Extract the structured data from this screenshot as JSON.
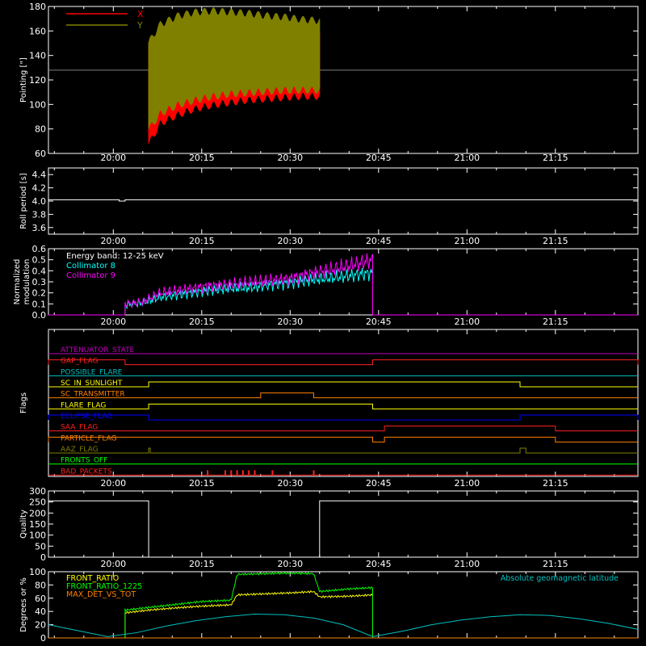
{
  "colors": {
    "background": "#000000",
    "axis": "#ffffff",
    "x_series": "#ff0000",
    "y_series": "#808000",
    "roll": "#ffffff",
    "coll8": "#00ffff",
    "coll9": "#ff00ff",
    "quality": "#ffffff",
    "front_ratio": "#ffff00",
    "front_ratio_1225": "#00ff00",
    "max_det": "#ff8000",
    "geomag": "#00c0c0",
    "pointing_ref": "#808080"
  },
  "time_axis": {
    "start": "19:49",
    "end": "21:29",
    "tick_labels": [
      "20:00",
      "20:15",
      "20:30",
      "20:45",
      "21:00",
      "21:15"
    ]
  },
  "chart_data": [
    {
      "type": "area",
      "ylabel": "Pointing [\"]",
      "yticks": [
        "60",
        "80",
        "100",
        "120",
        "140",
        "160",
        "180"
      ],
      "ylim": [
        60,
        180
      ],
      "reference_line": 128,
      "legend": [
        "X",
        "Y"
      ],
      "series": [
        {
          "name": "X",
          "t_range": [
            "20:06",
            "20:35"
          ],
          "upper_t": [
            "20:06",
            "20:08",
            "20:11",
            "20:14",
            "20:17",
            "20:20",
            "20:23",
            "20:26",
            "20:29",
            "20:32",
            "20:35"
          ],
          "upper": [
            150,
            162,
            165,
            165,
            165,
            163,
            162,
            160,
            160,
            158,
            157
          ],
          "lower": [
            68,
            85,
            92,
            97,
            100,
            102,
            104,
            105,
            106,
            107,
            107
          ]
        },
        {
          "name": "Y",
          "t_range": [
            "20:06",
            "20:35"
          ],
          "upper_t": [
            "20:06",
            "20:08",
            "20:11",
            "20:14",
            "20:17",
            "20:20",
            "20:23",
            "20:26",
            "20:29",
            "20:32",
            "20:35"
          ],
          "upper": [
            150,
            165,
            172,
            175,
            176,
            175,
            174,
            172,
            171,
            169,
            168
          ],
          "lower": [
            80,
            93,
            100,
            104,
            107,
            109,
            110,
            111,
            112,
            112,
            112
          ]
        }
      ]
    },
    {
      "type": "line",
      "ylabel": "Roll period [s]",
      "yticks": [
        "3.6",
        "3.8",
        "4.0",
        "4.2",
        "4.4"
      ],
      "ylim": [
        3.5,
        4.5
      ],
      "series": [
        {
          "name": "",
          "t": [
            "19:49",
            "20:01",
            "20:01",
            "20:02",
            "20:02",
            "21:29"
          ],
          "values": [
            4.02,
            4.02,
            4.0,
            4.0,
            4.02,
            4.02
          ]
        }
      ]
    },
    {
      "type": "line",
      "ylabel": "Normalized modulation",
      "yticks": [
        "0.0",
        "0.1",
        "0.2",
        "0.3",
        "0.4",
        "0.5",
        "0.6"
      ],
      "ylim": [
        0,
        0.6
      ],
      "legend": [
        "Energy band: 12-25 keV",
        "Collimator 8",
        "Collimator 9"
      ],
      "series": [
        {
          "name": "Collimator 8",
          "t": [
            "20:02",
            "20:05",
            "20:08",
            "20:12",
            "20:16",
            "20:20",
            "20:24",
            "20:26",
            "20:30",
            "20:34",
            "20:38",
            "20:42",
            "20:44"
          ],
          "values": [
            0.09,
            0.11,
            0.16,
            0.19,
            0.22,
            0.24,
            0.25,
            0.27,
            0.29,
            0.32,
            0.34,
            0.37,
            0.38
          ]
        },
        {
          "name": "Collimator 9",
          "t": [
            "20:02",
            "20:05",
            "20:08",
            "20:12",
            "20:16",
            "20:20",
            "20:24",
            "20:26",
            "20:30",
            "20:34",
            "20:38",
            "20:42",
            "20:44"
          ],
          "values": [
            0.1,
            0.12,
            0.2,
            0.23,
            0.26,
            0.28,
            0.3,
            0.31,
            0.33,
            0.38,
            0.42,
            0.47,
            0.5
          ]
        }
      ]
    },
    {
      "type": "line",
      "ylabel": "Flags",
      "flags": [
        {
          "name": "ATTENUATOR_STATE",
          "color": "#c000c0",
          "segments": []
        },
        {
          "name": "GAP_FLAG",
          "color": "#ff2020",
          "segments": [
            [
              "19:49",
              "20:02"
            ],
            [
              "20:44",
              "21:29"
            ]
          ]
        },
        {
          "name": "POSSIBLE_FLARE",
          "color": "#00c0c0",
          "segments": []
        },
        {
          "name": "SC_IN_SUNLIGHT",
          "color": "#ffff00",
          "segments": [
            [
              "20:06",
              "21:09"
            ]
          ]
        },
        {
          "name": "SC_TRANSMITTER",
          "color": "#ff8000",
          "segments": [
            [
              "20:25",
              "20:34"
            ]
          ]
        },
        {
          "name": "FLARE_FLAG",
          "color": "#ffff00",
          "segments": [
            [
              "20:06",
              "20:44"
            ]
          ]
        },
        {
          "name": "ECLIPSE_FLAG",
          "color": "#0000ff",
          "segments": [
            [
              "19:49",
              "20:06"
            ],
            [
              "21:09",
              "21:29"
            ]
          ]
        },
        {
          "name": "SAA_FLAG",
          "color": "#ff2020",
          "segments": [
            [
              "20:46",
              "21:15"
            ]
          ]
        },
        {
          "name": "PARTICLE_FLAG",
          "color": "#ff8000",
          "segments": [
            [
              "19:49",
              "20:44"
            ],
            [
              "20:46",
              "21:15"
            ]
          ]
        },
        {
          "name": "AAZ_FLAG",
          "color": "#808000",
          "segments": [
            [
              "20:06",
              "20:06"
            ],
            [
              "21:09",
              "21:10"
            ]
          ]
        },
        {
          "name": "FRONTS_OFF",
          "color": "#00ff00",
          "segments": []
        },
        {
          "name": "BAD_PACKETS",
          "color": "#ff2020",
          "segments": [],
          "spikes": [
            "20:16",
            "20:19",
            "20:20",
            "20:21",
            "20:22",
            "20:23",
            "20:24",
            "20:27",
            "20:34"
          ]
        }
      ]
    },
    {
      "type": "line",
      "ylabel": "Quality",
      "yticks": [
        "0",
        "50",
        "100",
        "150",
        "200",
        "250",
        "300"
      ],
      "ylim": [
        0,
        300
      ],
      "series": [
        {
          "name": "",
          "t": [
            "19:49",
            "20:06",
            "20:06",
            "20:35",
            "20:35",
            "21:29"
          ],
          "values": [
            255,
            255,
            0,
            0,
            255,
            255
          ]
        }
      ]
    },
    {
      "type": "line",
      "ylabel": "Degrees or %",
      "yticks": [
        "0",
        "20",
        "40",
        "60",
        "80",
        "100"
      ],
      "ylim": [
        0,
        100
      ],
      "legend": [
        "FRONT_RATIO",
        "FRONT_RATIO_1225",
        "MAX_DET_VS_TOT"
      ],
      "right_legend": "Absolute geomagnetic latitude",
      "series": [
        {
          "name": "FRONT_RATIO",
          "t": [
            "20:02",
            "20:06",
            "20:10",
            "20:15",
            "20:20",
            "20:21",
            "20:30",
            "20:34",
            "20:35",
            "20:40",
            "20:44"
          ],
          "values": [
            38,
            42,
            45,
            48,
            50,
            65,
            68,
            70,
            62,
            63,
            65
          ]
        },
        {
          "name": "FRONT_RATIO_1225",
          "t": [
            "20:02",
            "20:06",
            "20:10",
            "20:15",
            "20:20",
            "20:21",
            "20:30",
            "20:34",
            "20:35",
            "20:40",
            "20:44"
          ],
          "values": [
            42,
            46,
            50,
            55,
            57,
            96,
            98,
            97,
            70,
            74,
            76
          ]
        },
        {
          "name": "MAX_DET_VS_TOT",
          "t": [
            "19:49",
            "21:29"
          ],
          "values": [
            0,
            0
          ]
        },
        {
          "name": "Absolute geomagnetic latitude",
          "t": [
            "19:49",
            "19:54",
            "19:59",
            "20:04",
            "20:09",
            "20:14",
            "20:19",
            "20:24",
            "20:29",
            "20:34",
            "20:39",
            "20:44",
            "20:49",
            "20:54",
            "20:59",
            "21:04",
            "21:09",
            "21:14",
            "21:19",
            "21:24",
            "21:29"
          ],
          "values": [
            20,
            11,
            2,
            8,
            18,
            26,
            32,
            36,
            35,
            30,
            20,
            2,
            10,
            20,
            27,
            32,
            35,
            34,
            29,
            22,
            13
          ]
        }
      ]
    }
  ]
}
